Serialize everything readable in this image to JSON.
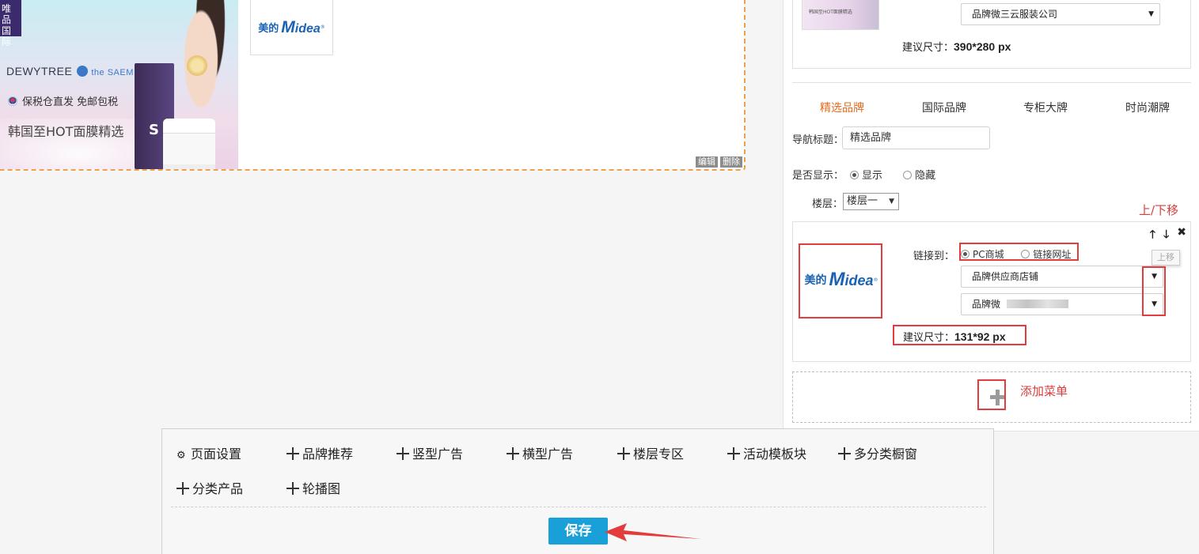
{
  "preview": {
    "banner": {
      "badge_line1": "唯品",
      "badge_line2": "国际",
      "brand_left": "DEWYTREE",
      "brand_right": "the SAEM",
      "tagline": "保税仓直发 免邮包税",
      "headline": "韩国至HOT面膜精选",
      "product_letter": "S"
    },
    "thumb_logo": {
      "cn": "美的",
      "en": "Midea"
    },
    "edit_label": "编辑",
    "delete_label": "删除"
  },
  "panel": {
    "top_card": {
      "thumb_text": "韩国至HOT面膜精选",
      "shop_select": "品牌微三云服装公司",
      "size_label": "建议尺寸：",
      "size_value": "390*280 px"
    },
    "tabs": [
      {
        "label": "精选品牌",
        "active": true
      },
      {
        "label": "国际品牌",
        "active": false
      },
      {
        "label": "专柜大牌",
        "active": false
      },
      {
        "label": "时尚潮牌",
        "active": false
      }
    ],
    "nav_title_label": "导航标题：",
    "nav_title_value": "精选品牌",
    "display_label": "是否显示：",
    "display_options": {
      "show": "显示",
      "hide": "隐藏"
    },
    "floor_label": "楼层：",
    "floor_value": "楼层一",
    "annotation_move": "上/下移",
    "item": {
      "logo": {
        "cn": "美的",
        "en": "Midea"
      },
      "link_label": "链接到：",
      "link_options": {
        "pc": "PC商城",
        "url": "链接网址"
      },
      "select1": "品牌供应商店铺",
      "select2": "品牌微",
      "size_label": "建议尺寸：",
      "size_value": "131*92 px",
      "tooltip": "上移",
      "icons": [
        "arrow-up-icon",
        "arrow-down-icon",
        "close-icon"
      ]
    },
    "annotation_add": "添加菜单"
  },
  "toolbar": {
    "items": [
      {
        "label": "页面设置",
        "icon": "gear-icon"
      },
      {
        "label": "品牌推荐",
        "icon": "plus-icon"
      },
      {
        "label": "竖型广告",
        "icon": "plus-icon"
      },
      {
        "label": "横型广告",
        "icon": "plus-icon"
      },
      {
        "label": "楼层专区",
        "icon": "plus-icon"
      },
      {
        "label": "活动模板块",
        "icon": "plus-icon"
      },
      {
        "label": "多分类橱窗",
        "icon": "plus-icon"
      },
      {
        "label": "分类产品",
        "icon": "plus-icon"
      },
      {
        "label": "轮播图",
        "icon": "plus-icon"
      }
    ],
    "save_label": "保存"
  },
  "colors": {
    "accent": "#1aa0d8",
    "active_tab": "#e5691f",
    "annotation_red": "#e23c3c",
    "dashed_border": "#f0a04a"
  }
}
